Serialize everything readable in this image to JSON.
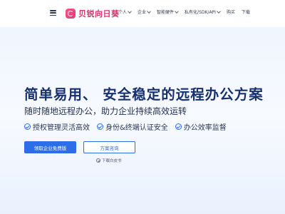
{
  "brand": {
    "name": "贝锐向日葵"
  },
  "nav": {
    "items": [
      {
        "label": "个人",
        "has_dropdown": true
      },
      {
        "label": "企业",
        "has_dropdown": true
      },
      {
        "label": "智能硬件",
        "has_dropdown": true
      },
      {
        "label": "私有化/SDK/API",
        "has_dropdown": true
      },
      {
        "label": "购买",
        "has_dropdown": false
      },
      {
        "label": "下载",
        "has_dropdown": false
      }
    ]
  },
  "hero": {
    "title": "简单易用、 安全稳定的远程办公方案",
    "subtitle": "随时随地远程办公，助力企业持续高效运转",
    "features": [
      {
        "icon": "check-circle-icon",
        "label": "授权管理灵活高效"
      },
      {
        "icon": "check-circle-icon",
        "label": "身份&终端认证安全"
      },
      {
        "icon": "check-circle-icon",
        "label": "办公效率监督"
      }
    ],
    "primary_button": "领取企业免费版",
    "secondary_button": "方案咨询",
    "download_link": "下载白皮书"
  },
  "colors": {
    "accent": "#2c6ee8",
    "brand": "#d8346a",
    "title": "#17306f"
  }
}
